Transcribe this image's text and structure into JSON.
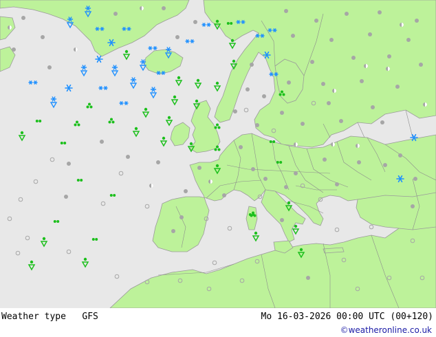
{
  "product": "Weather type",
  "model": "GFS",
  "valid_time": "Mo 16-03-2026 00:00 UTC (00+120)",
  "credit": "©weatheronline.co.uk",
  "colors": {
    "sea": "#e8e8e8",
    "land": "#bdf29a",
    "border": "#9a9a9a",
    "snow": "#1f90ff",
    "rain": "#1cbf1c",
    "dry": "#a6a6a6"
  },
  "legend_symbols": {
    "snow": "snowflake-icon",
    "snow_shower": "snow-shower-icon",
    "rain": "rain-drops-icon",
    "rain_shower": "rain-shower-icon",
    "showers_cluster": "shower-cluster-icon",
    "dry": "dry-dot-icon"
  }
}
